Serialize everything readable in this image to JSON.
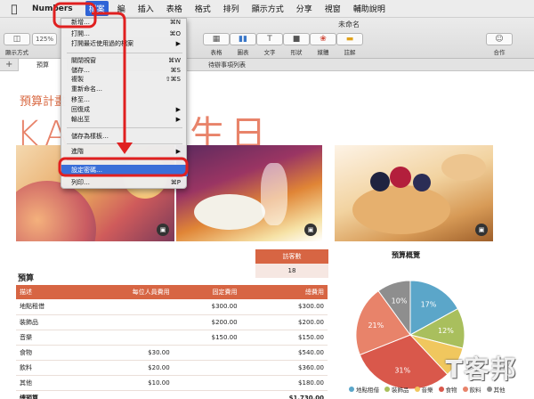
{
  "menubar": {
    "app_name": "Numbers",
    "items": [
      "檔案",
      "編",
      "插入",
      "表格",
      "格式",
      "排列",
      "顯示方式",
      "分享",
      "視窗",
      "輔助說明"
    ]
  },
  "window": {
    "title": "未命名",
    "toolbar": {
      "view_label": "顯示方式",
      "zoom_value": "125%",
      "items": [
        "表格",
        "圖表",
        "文字",
        "形狀",
        "媒體",
        "註解"
      ],
      "share_label": "合作"
    },
    "sheet_tabs": [
      "預算",
      "待辦事項列表"
    ]
  },
  "file_menu": {
    "items": [
      {
        "label": "新增…",
        "shortcut": "⌘N"
      },
      {
        "label": "打開…",
        "shortcut": "⌘O"
      },
      {
        "label": "打開最近使用過的檔案",
        "submenu": true
      },
      {
        "label": "關閉視窗",
        "shortcut": "⌘W"
      },
      {
        "label": "儲存…",
        "shortcut": "⌘S"
      },
      {
        "label": "複製",
        "shortcut": "⇧⌘S"
      },
      {
        "label": "重新命名…"
      },
      {
        "label": "移至…"
      },
      {
        "label": "回復成",
        "submenu": true
      },
      {
        "label": "輸出至",
        "submenu": true
      },
      {
        "label": "儲存為樣板…"
      },
      {
        "label": "進階",
        "submenu": true
      },
      {
        "label": "設定密碼…",
        "highlighted": true
      },
      {
        "label": "列印…",
        "shortcut": "⌘P"
      }
    ]
  },
  "document": {
    "heading": "預算計畫",
    "title_left": "KA",
    "title_right": "生日",
    "guest_card": {
      "header": "訪客數",
      "value": "18"
    },
    "budget": {
      "title": "預算",
      "columns": [
        "描述",
        "每位人員費用",
        "固定費用",
        "總費用"
      ],
      "rows": [
        [
          "地點租借",
          "",
          "$300.00",
          "$300.00"
        ],
        [
          "裝飾品",
          "",
          "$200.00",
          "$200.00"
        ],
        [
          "音樂",
          "",
          "$150.00",
          "$150.00"
        ],
        [
          "食物",
          "$30.00",
          "",
          "$540.00"
        ],
        [
          "飲料",
          "$20.00",
          "",
          "$360.00"
        ],
        [
          "其他",
          "$10.00",
          "",
          "$180.00"
        ]
      ],
      "total": [
        "總預算",
        "",
        "",
        "$1,730.00"
      ]
    },
    "pie": {
      "title": "預算概覽",
      "slices": [
        {
          "label": "地點租借",
          "percent": 17,
          "color": "#5ba6c9"
        },
        {
          "label": "裝飾品",
          "percent": 12,
          "color": "#a9bf5d"
        },
        {
          "label": "音樂",
          "percent": 9,
          "color": "#f0c75e"
        },
        {
          "label": "食物",
          "percent": 31,
          "color": "#d9584b"
        },
        {
          "label": "飲料",
          "percent": 21,
          "color": "#e8836a"
        },
        {
          "label": "其他",
          "percent": 10,
          "color": "#8e8e8e"
        }
      ],
      "slice_labels": [
        "17%",
        "12%",
        "31%",
        "21%",
        "10%"
      ]
    },
    "legend": [
      "地點租借",
      "裝飾品",
      "音樂",
      "食物",
      "飲料",
      "其他"
    ]
  },
  "colors": {
    "accent": "#d76543",
    "menu_highlight": "#3a6fd8",
    "annotation": "#e02020"
  },
  "watermark": "T客邦"
}
